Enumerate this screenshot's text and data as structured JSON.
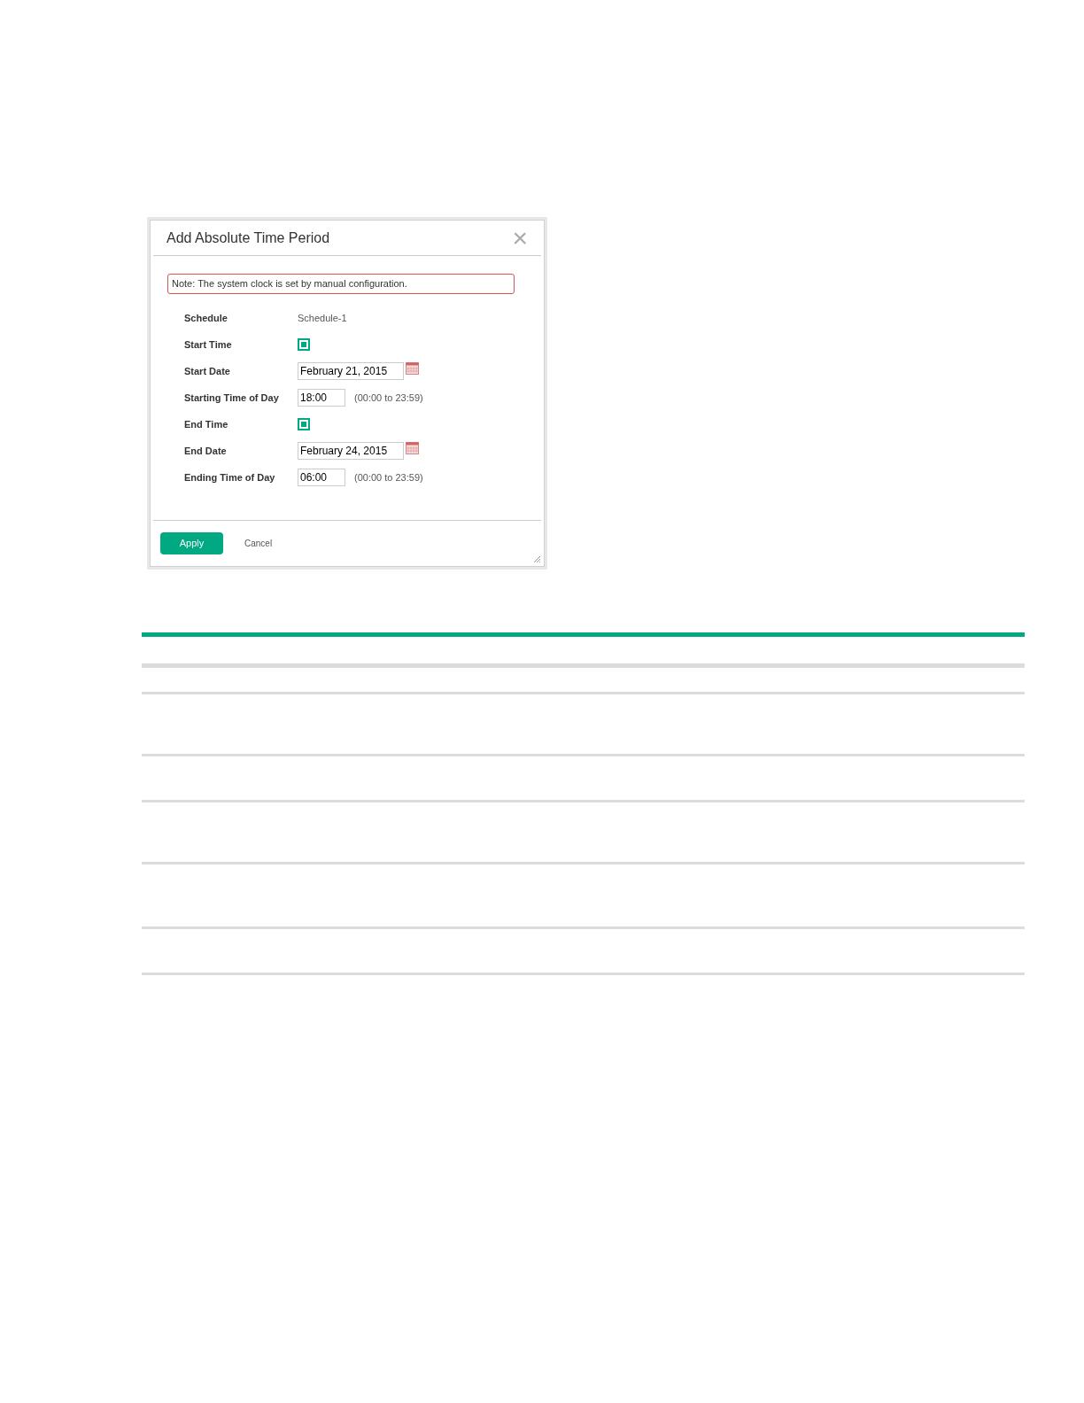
{
  "dialog": {
    "title": "Add Absolute Time Period",
    "close": "×",
    "note": "Note: The system clock is set by manual configuration.",
    "fields": [
      {
        "kind": "text",
        "label": "Schedule",
        "value": "Schedule-1"
      },
      {
        "kind": "checkbox",
        "label": "Start Time",
        "checked": true
      },
      {
        "kind": "date",
        "label": "Start Date",
        "value": "February 21, 2015"
      },
      {
        "kind": "time",
        "label": "Starting Time of Day",
        "value": "18:00",
        "hint": "(00:00 to 23:59)"
      },
      {
        "kind": "checkbox",
        "label": "End Time",
        "checked": true
      },
      {
        "kind": "date",
        "label": "End Date",
        "value": "February 24, 2015"
      },
      {
        "kind": "time",
        "label": "Ending Time of Day",
        "value": "06:00",
        "hint": "(00:00 to 23:59)"
      }
    ],
    "buttons": [
      {
        "kind": "primary",
        "label": "Apply"
      },
      {
        "kind": "link",
        "label": "Cancel"
      }
    ]
  }
}
